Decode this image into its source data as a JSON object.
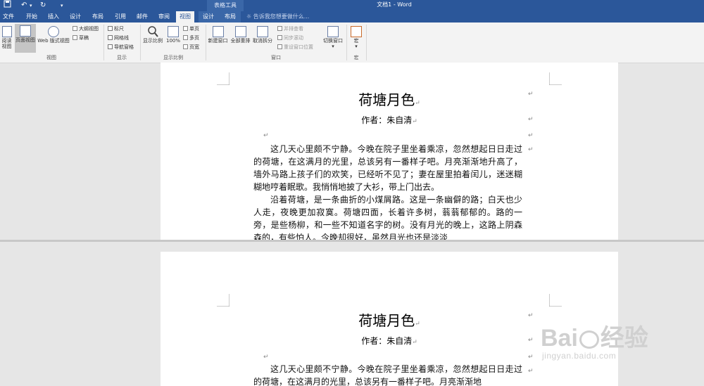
{
  "window": {
    "title": "文档1 - Word",
    "context_tool_title": "表格工具"
  },
  "quick_access": {
    "save_icon": "save-icon",
    "undo_icon": "undo-icon",
    "redo_icon": "redo-icon",
    "customize_icon": "customize-icon"
  },
  "tabs": [
    "文件",
    "开始",
    "插入",
    "设计",
    "布局",
    "引用",
    "邮件",
    "审阅",
    "视图",
    "设计",
    "布局"
  ],
  "active_tab": "视图",
  "tell_me": "告诉我您想要做什么...",
  "ribbon": {
    "views": {
      "read_mode": "阅读视图",
      "print_layout": "页面视图",
      "web_layout": "Web 版式视图",
      "outline": "大纲视图",
      "draft": "草稿",
      "group_label": "视图"
    },
    "show": {
      "ruler": "标尺",
      "gridlines": "网格线",
      "nav_pane": "导航窗格",
      "group_label": "显示"
    },
    "zoom": {
      "zoom": "显示比例",
      "hundred": "100%",
      "one_page": "单页",
      "multi_page": "多页",
      "page_width": "页宽",
      "group_label": "显示比例"
    },
    "window": {
      "new_window": "新建窗口",
      "arrange_all": "全部重排",
      "split": "取消拆分",
      "side_by_side": "并排查看",
      "sync_scroll": "同步滚动",
      "reset_position": "重设窗口位置",
      "switch_windows": "切换窗口",
      "group_label": "窗口"
    },
    "macros": {
      "macros": "宏",
      "group_label": "宏"
    }
  },
  "document": {
    "title": "荷塘月色",
    "author": "作者：朱自清",
    "paragraph1": "这几天心里颇不宁静。今晚在院子里坐着乘凉，忽然想起日日走过的荷塘，在这满月的光里，总该另有一番样子吧。月亮渐渐地升高了，墙外马路上孩子们的欢笑，已经听不见了；妻在屋里拍着闰儿，迷迷糊糊地哼着眠歌。我悄悄地披了大衫，带上门出去。",
    "paragraph2": "沿着荷塘，是一条曲折的小煤屑路。这是一条幽僻的路；白天也少人走，夜晚更加寂寞。荷塘四面，长着许多树，蓊蓊郁郁的。路的一旁，是些杨柳，和一些不知道名字的树。没有月光的晚上，这路上阴森森的，有些怕人。今晚却很好，虽然月光也还是淡淡",
    "page2_paragraph1": "这几天心里颇不宁静。今晚在院子里坐着乘凉，忽然想起日日走过的荷塘，在这满月的光里，总该另有一番样子吧。月亮渐渐地"
  },
  "watermark": {
    "logo_text": "Bai 经验",
    "url": "jingyan.baidu.com"
  },
  "colors": {
    "accent": "#2b579a",
    "ribbon_bg": "#f3f3f3",
    "canvas_bg": "#e6e6e6"
  }
}
